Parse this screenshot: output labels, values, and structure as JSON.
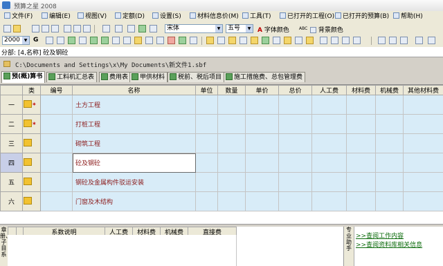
{
  "title": "预算之星 2008",
  "menu": [
    "文件(F)",
    "编辑(E)",
    "视图(V)",
    "定额(D)",
    "设置(S)",
    "材料信息价(M)",
    "工具(T)",
    "已打开的工程(O)",
    "已打开的预算(B)",
    "帮助(H)"
  ],
  "toolbar": {
    "font_name": "宋体",
    "font_size": "五号",
    "font_color_label": "字体颜色",
    "abc_label": "ABC",
    "bg_color_label": "背景颜色",
    "year_value": "2000",
    "g_label": "G"
  },
  "formula_bar": "分部: [4,名称] 砼及钢砼",
  "file_path": "C:\\Documents and Settings\\x\\My Documents\\新文件1.sbf",
  "tabs": [
    "预(概)算书",
    "工料机汇总表",
    "费用表",
    "甲供材料",
    "税前、税后项目",
    "施工措施费、总包管理费"
  ],
  "grid": {
    "columns": [
      "类",
      "编号",
      "名称",
      "单位",
      "数量",
      "单价",
      "总价",
      "人工费",
      "材料费",
      "机械费",
      "其他材料费"
    ],
    "rows": [
      {
        "no": "一",
        "star": "*",
        "name": "土方工程"
      },
      {
        "no": "二",
        "star": "*",
        "name": "打桩工程"
      },
      {
        "no": "三",
        "star": "",
        "name": "砌筑工程"
      },
      {
        "no": "四",
        "star": "",
        "name": "砼及钢砼"
      },
      {
        "no": "五",
        "star": "",
        "name": "钢砼及金属构件驳运安装"
      },
      {
        "no": "六",
        "star": "",
        "name": "门窗及木结构"
      }
    ],
    "selected_row": 3
  },
  "lower_panel": {
    "side_label": "章册、子目系",
    "columns": [
      "系数说明",
      "人工费",
      "材料费",
      "机械费",
      "直接费"
    ]
  },
  "assistant": {
    "side_label": "专业助手",
    "links": [
      ">>查阅工作内容",
      ">>查阅资料库相关信息"
    ]
  }
}
